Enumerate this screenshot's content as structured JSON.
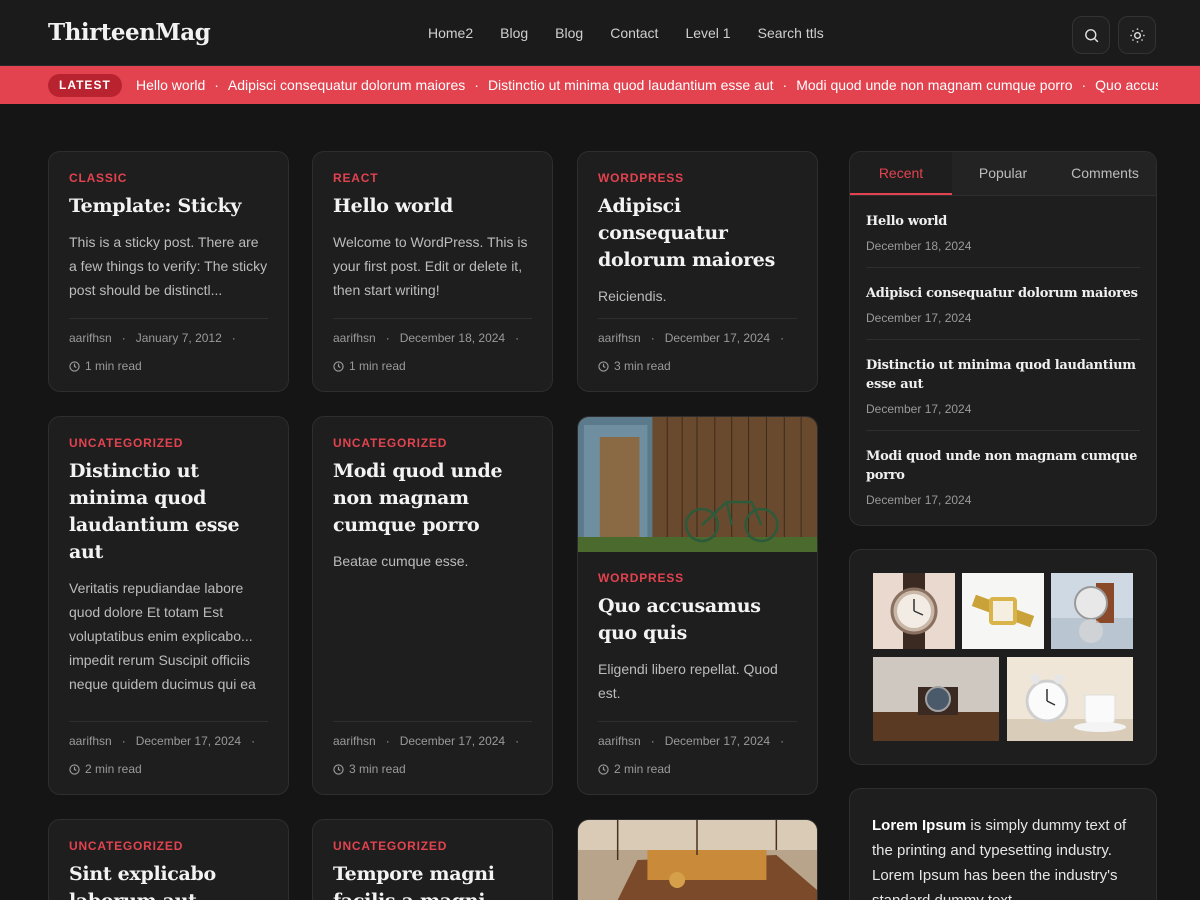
{
  "site": {
    "logo": "ThirteenMag"
  },
  "nav": [
    "Home2",
    "Blog",
    "Blog",
    "Contact",
    "Level 1",
    "Search ttls"
  ],
  "header_icons": [
    "search-icon",
    "sun-icon"
  ],
  "ticker": {
    "badge": "LATEST",
    "items": [
      "Hello world",
      "Adipisci consequatur dolorum maiores",
      "Distinctio ut minima quod laudantium esse aut",
      "Modi quod unde non magnam cumque porro",
      "Quo accusamus quo quis"
    ]
  },
  "posts": [
    {
      "category": "CLASSIC",
      "title": "Template: Sticky",
      "excerpt": "This is a sticky post. There are a few things to verify: The sticky post should be distinctl...",
      "author": "aarifhsn",
      "date": "January 7, 2012",
      "read": "1 min read"
    },
    {
      "category": "REACT",
      "title": "Hello world",
      "excerpt": "Welcome to WordPress. This is your first post. Edit or delete it, then start writing!",
      "author": "aarifhsn",
      "date": "December 18, 2024",
      "read": "1 min read"
    },
    {
      "category": "WORDPRESS",
      "title": "Adipisci consequatur dolorum maiores",
      "excerpt": "Reiciendis.",
      "author": "aarifhsn",
      "date": "December 17, 2024",
      "read": "3 min read"
    },
    {
      "category": "UNCATEGORIZED",
      "title": "Distinctio ut minima quod laudantium esse aut",
      "excerpt": "Veritatis repudiandae labore quod dolore Et totam Est voluptatibus enim explicabo... impedit rerum Suscipit officiis neque quidem ducimus qui ea",
      "author": "aarifhsn",
      "date": "December 17, 2024",
      "read": "2 min read"
    },
    {
      "category": "UNCATEGORIZED",
      "title": "Modi quod unde non magnam cumque porro",
      "excerpt": "Beatae cumque esse.",
      "author": "aarifhsn",
      "date": "December 17, 2024",
      "read": "3 min read"
    },
    {
      "category": "WORDPRESS",
      "title": "Quo accusamus quo quis",
      "excerpt": "Eligendi libero repellat. Quod est.",
      "author": "aarifhsn",
      "date": "December 17, 2024",
      "read": "2 min read"
    },
    {
      "category": "UNCATEGORIZED",
      "title": "Sint explicabo laborum aut"
    },
    {
      "category": "UNCATEGORIZED",
      "title": "Tempore magni facilis a magni"
    }
  ],
  "sidebar": {
    "tabs": [
      "Recent",
      "Popular",
      "Comments"
    ],
    "recent": [
      {
        "title": "Hello world",
        "date": "December 18, 2024"
      },
      {
        "title": "Adipisci consequatur dolorum maiores",
        "date": "December 17, 2024"
      },
      {
        "title": "Distinctio ut minima quod laudantium esse aut",
        "date": "December 17, 2024"
      },
      {
        "title": "Modi quod unde non magnam cumque porro",
        "date": "December 17, 2024"
      }
    ],
    "lorem_bold": "Lorem Ipsum",
    "lorem_rest": " is simply dummy text of the printing and typesetting industry. Lorem Ipsum has been the industry's standard dummy text"
  },
  "colors": {
    "accent": "#e2434f",
    "background": "#151515",
    "card": "#1e1e1e"
  }
}
